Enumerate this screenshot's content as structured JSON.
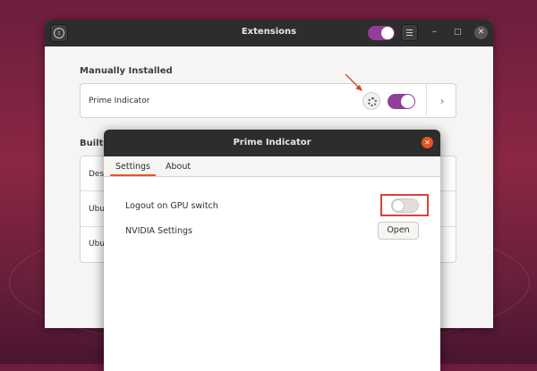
{
  "main_window": {
    "title": "Extensions",
    "info_glyph": "i",
    "minimize_glyph": "–",
    "maximize_glyph": "□",
    "close_glyph": "✕",
    "extensions_enabled": true
  },
  "manually_installed": {
    "heading": "Manually Installed",
    "items": [
      {
        "name": "Prime Indicator",
        "enabled": true,
        "chevron": "›"
      }
    ]
  },
  "built_in": {
    "heading_visible": "Built-i",
    "rows": [
      {
        "label_visible": "Des"
      },
      {
        "label_visible": "Ubu"
      },
      {
        "label_visible": "Ubu"
      }
    ]
  },
  "dialog": {
    "title": "Prime Indicator",
    "close_glyph": "✕",
    "tabs": [
      {
        "label": "Settings",
        "active": true
      },
      {
        "label": "About",
        "active": false
      }
    ],
    "options": {
      "logout_label": "Logout on GPU switch",
      "logout_enabled": false,
      "nvidia_label": "NVIDIA Settings",
      "open_button": "Open"
    }
  },
  "colors": {
    "accent_purple": "#933e98",
    "ubuntu_orange": "#e95420",
    "highlight_red": "#d9413b",
    "headerbar": "#2d2d2d"
  }
}
